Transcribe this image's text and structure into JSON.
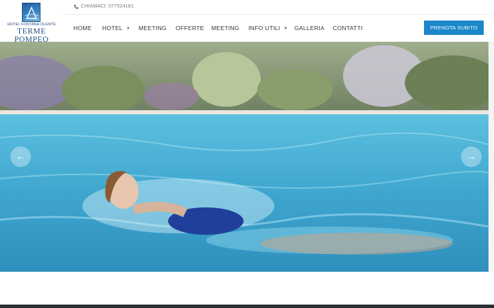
{
  "logo": {
    "subtitle": "HOTEL FONTANA OLENTE",
    "title": "TERME POMPEO"
  },
  "topbar": {
    "phone_icon": "phone-icon",
    "phone_text": "CHIAMACI: 077524181"
  },
  "nav": {
    "items": [
      {
        "label": "HOME",
        "has_dropdown": false
      },
      {
        "label": "HOTEL",
        "has_dropdown": true
      },
      {
        "label": "MEETING",
        "has_dropdown": false
      },
      {
        "label": "OFFERTE",
        "has_dropdown": false
      },
      {
        "label": "MEETING",
        "has_dropdown": false
      },
      {
        "label": "INFO UTILI",
        "has_dropdown": true
      },
      {
        "label": "GALLERIA",
        "has_dropdown": false
      },
      {
        "label": "CONTATTI",
        "has_dropdown": false
      }
    ],
    "dropdown_glyph": "▼"
  },
  "cta": {
    "label": "PRENOTA SUBITO",
    "color": "#1b87c9"
  },
  "hero": {
    "prev_icon": "arrow-left-icon",
    "next_icon": "arrow-right-icon",
    "prev_glyph": "←",
    "next_glyph": "→"
  },
  "colors": {
    "accent": "#1b87c9",
    "brand": "#1d4f86",
    "footer": "#2b2e33"
  }
}
